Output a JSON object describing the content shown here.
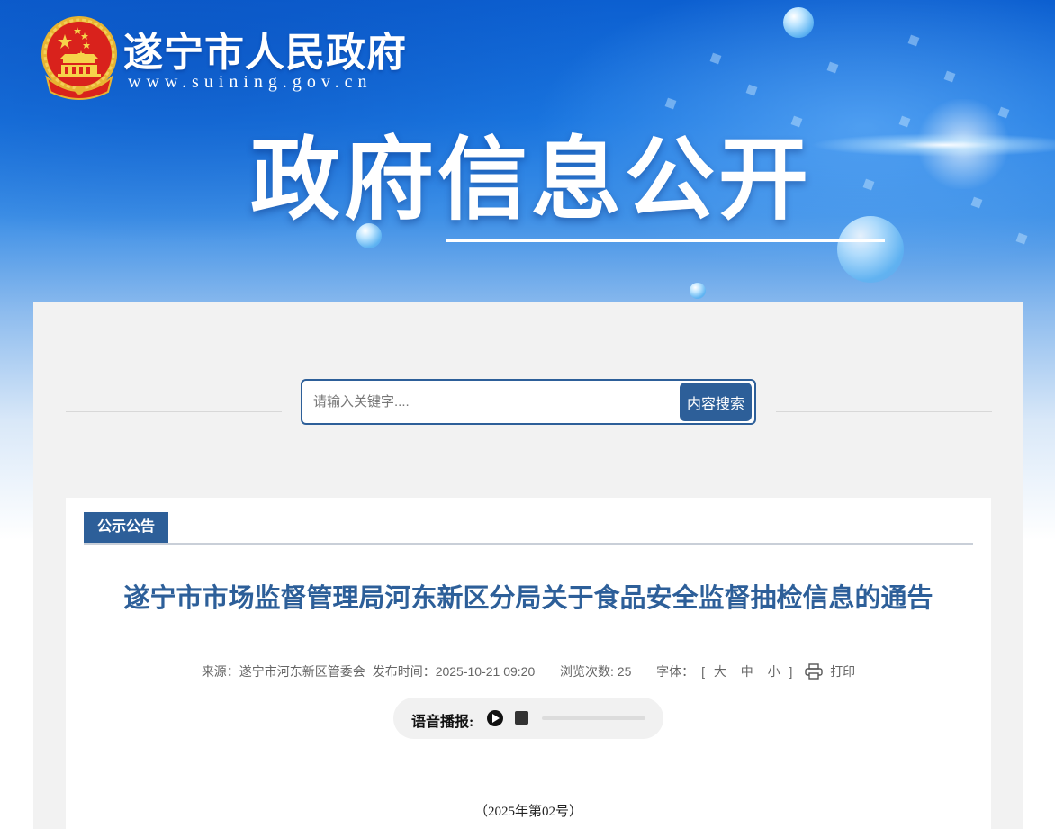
{
  "header": {
    "site_name": "遂宁市人民政府",
    "site_url": "www.suining.gov.cn",
    "section_title": "政府信息公开"
  },
  "search": {
    "placeholder": "请输入关键字....",
    "button_label": "内容搜索"
  },
  "article": {
    "category_tab": "公示公告",
    "title": "遂宁市市场监督管理局河东新区分局关于食品安全监督抽检信息的通告",
    "meta": {
      "source": "来源：遂宁市河东新区管委会",
      "publish_time": "发布时间：2025-10-21 09:20",
      "views": "浏览次数: 25",
      "font_label": "字体：",
      "bracket_open": "[",
      "font_large": "大",
      "font_medium": "中",
      "font_small": "小",
      "bracket_close": "]",
      "print_label": "打印"
    },
    "voice": {
      "label": "语音播报:"
    },
    "doc_number": "（2025年第02号）"
  },
  "colors": {
    "primary": "#2d5f99",
    "banner": "#1a76e0",
    "container_bg": "#f2f2f2"
  },
  "icons": {
    "emblem": "national-emblem-icon",
    "print": "print-icon",
    "play": "play-icon",
    "stop": "stop-icon"
  }
}
